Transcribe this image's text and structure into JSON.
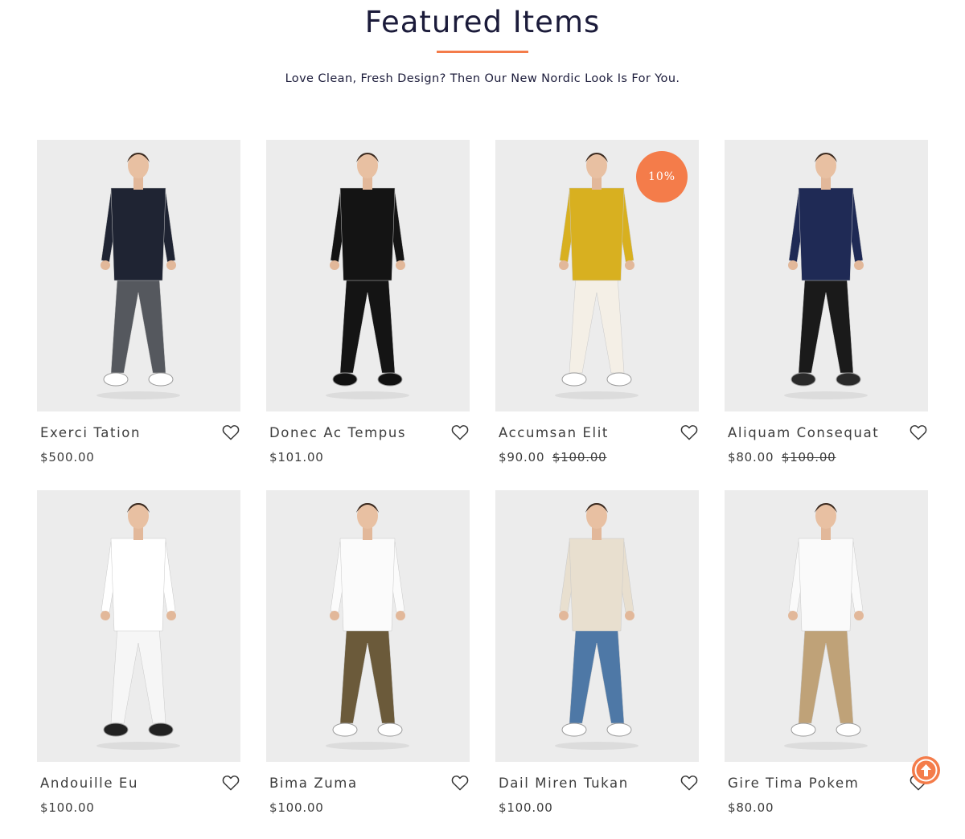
{
  "section": {
    "title": "Featured Items",
    "subtitle": "Love Clean, Fresh Design? Then Our New Nordic Look Is For You."
  },
  "accent_color": "#f47c4a",
  "products": [
    {
      "name": "Exerci Tation",
      "price": "$500.00",
      "old_price": "",
      "badge": "",
      "top": "#1f2433",
      "bottom": "#55585e",
      "shoes": "#ffffff"
    },
    {
      "name": "Donec Ac Tempus",
      "price": "$101.00",
      "old_price": "",
      "badge": "",
      "top": "#141414",
      "bottom": "#141414",
      "shoes": "#111111"
    },
    {
      "name": "Accumsan Elit",
      "price": "$90.00",
      "old_price": "$100.00",
      "badge": "10%",
      "top": "#d8b020",
      "bottom": "#f4efe6",
      "shoes": "#ffffff"
    },
    {
      "name": "Aliquam Consequat",
      "price": "$80.00",
      "old_price": "$100.00",
      "badge": "",
      "top": "#1f2a55",
      "bottom": "#1a1a1a",
      "shoes": "#2a2a2a"
    },
    {
      "name": "Andouille Eu",
      "price": "$100.00",
      "old_price": "",
      "badge": "",
      "top": "#ffffff",
      "bottom": "#f6f6f6",
      "shoes": "#222222"
    },
    {
      "name": "Bima Zuma",
      "price": "$100.00",
      "old_price": "",
      "badge": "",
      "top": "#fbfbfb",
      "bottom": "#6b5a3a",
      "shoes": "#ffffff"
    },
    {
      "name": "Dail Miren Tukan",
      "price": "$100.00",
      "old_price": "",
      "badge": "",
      "top": "#e8dfcf",
      "bottom": "#4e78a6",
      "shoes": "#ffffff"
    },
    {
      "name": "Gire Tima Pokem",
      "price": "$80.00",
      "old_price": "",
      "badge": "",
      "top": "#fafafa",
      "bottom": "#bfa278",
      "shoes": "#ffffff"
    }
  ],
  "icons": {
    "wishlist": "heart-icon",
    "scroll": "arrow-up-icon"
  }
}
